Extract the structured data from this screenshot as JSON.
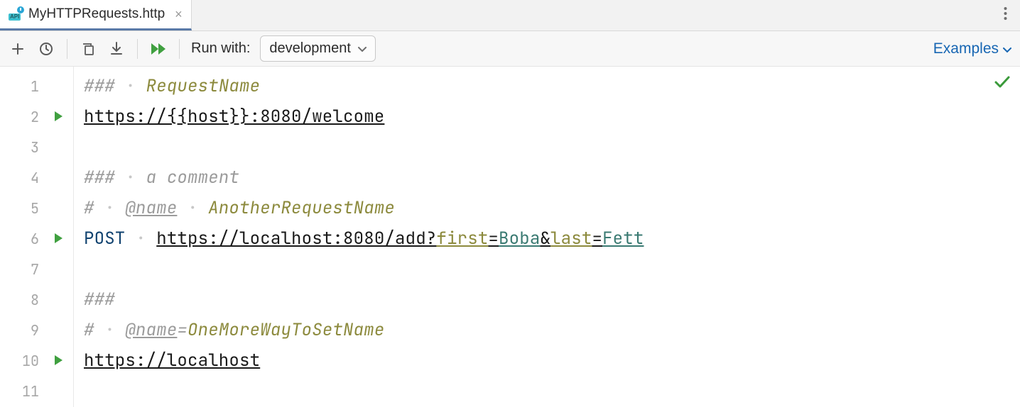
{
  "tab": {
    "filename": "MyHTTPRequests.http",
    "icon_label": "API"
  },
  "toolbar": {
    "run_with_label": "Run with:",
    "env_selected": "development",
    "examples_label": "Examples"
  },
  "gutter": {
    "line_numbers": [
      "1",
      "2",
      "3",
      "4",
      "5",
      "6",
      "7",
      "8",
      "9",
      "10",
      "11"
    ],
    "run_markers_on": [
      2,
      6,
      10
    ]
  },
  "code": {
    "l1": {
      "hash": "###",
      "name": "RequestName"
    },
    "l2": {
      "url": "https://{{host}}:8080/welcome"
    },
    "l4": {
      "hash": "###",
      "comment": "a comment"
    },
    "l5": {
      "hash": "#",
      "nameKw": "@name",
      "name": "AnotherRequestName"
    },
    "l6": {
      "method": "POST",
      "url_base": "https://localhost:8080/add?",
      "p1k": "first",
      "p1v": "Boba",
      "amp": "&",
      "p2k": "last",
      "p2v": "Fett"
    },
    "l8": {
      "hash": "###"
    },
    "l9": {
      "hash": "#",
      "nameKw": "@name",
      "eq": "=",
      "name": "OneMoreWayToSetName"
    },
    "l10": {
      "url": "https://localhost"
    }
  }
}
